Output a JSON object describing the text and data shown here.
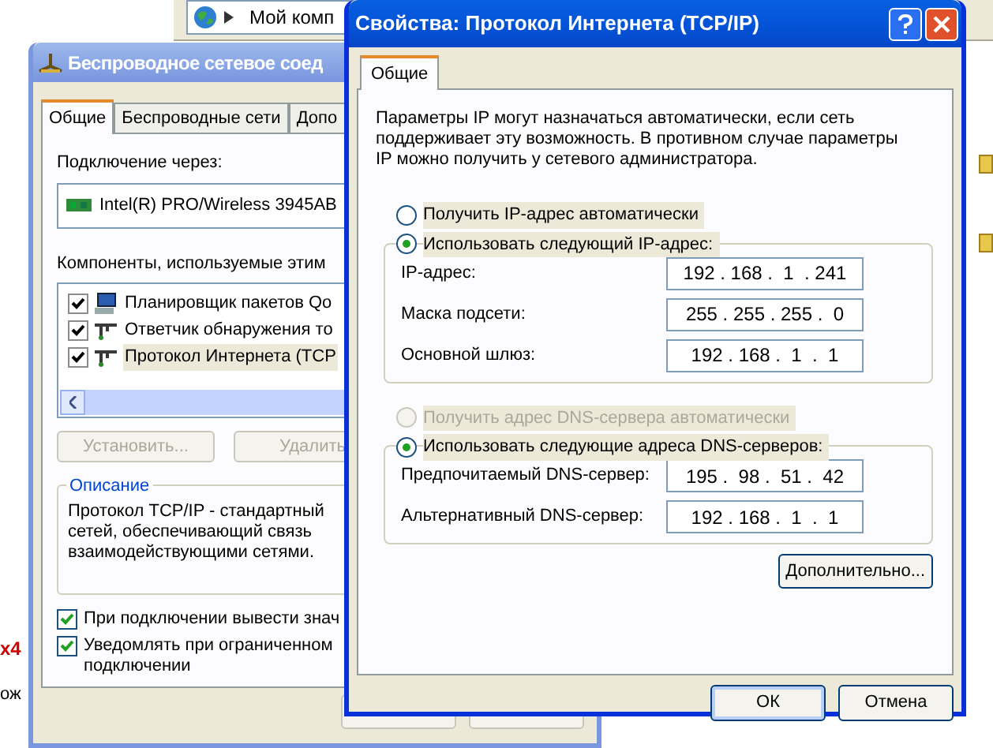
{
  "explorer_window": {
    "address": "Мой комп"
  },
  "background_texts": [
    {
      "text": "x4",
      "kind": "accent"
    },
    {
      "text": "ож",
      "kind": "plain"
    }
  ],
  "network_window": {
    "title": "Беспроводное сетевое соед",
    "tabs": [
      {
        "label": "Общие",
        "selected": true
      },
      {
        "label": "Беспроводные сети",
        "selected": false
      },
      {
        "label": "Допо",
        "selected": false
      }
    ],
    "connect_via_label": "Подключение через:",
    "adapter": "Intel(R) PRO/Wireless 3945AB",
    "components_label": "Компоненты, используемые этим",
    "components": [
      {
        "name": "Планировщик пакетов Qo",
        "checked": true,
        "kind": "scheduler"
      },
      {
        "name": "Ответчик обнаружения то",
        "checked": true,
        "kind": "protocol"
      },
      {
        "name": "Протокол Интернета (TCP",
        "checked": true,
        "kind": "protocol",
        "selected": true
      }
    ],
    "buttons": [
      {
        "label": "Установить...",
        "disabled": true
      },
      {
        "label": "Удалить",
        "disabled": true
      }
    ],
    "description": {
      "title": "Описание",
      "lines": [
        "Протокол TCP/IP - стандартный",
        "сетей, обеспечивающий связь",
        "взаимодействующими сетями."
      ]
    },
    "options": [
      {
        "lines": [
          "При подключении вывести знач"
        ],
        "checked": true
      },
      {
        "lines": [
          "Уведомлять при ограниченном",
          "подключении"
        ],
        "checked": true
      }
    ]
  },
  "tcpip_dialog": {
    "title": "Свойства: Протокол Интернета (TCP/IP)",
    "tabs": [
      {
        "label": "Общие",
        "selected": true
      }
    ],
    "intro": "Параметры IP могут назначаться автоматически, если сеть поддерживает эту возможность. В противном случае параметры IP можно получить у сетевого администратора.",
    "sections": [
      {
        "auto": {
          "label": "Получить IP-адрес автоматически",
          "selected": false,
          "disabled": false
        },
        "manual": {
          "label": "Использовать следующий IP-адрес:",
          "selected": true,
          "disabled": false
        },
        "fields": [
          {
            "label": "IP-адрес:",
            "value": "192 . 168 .  1  . 241"
          },
          {
            "label": "Маска подсети:",
            "value": "255 . 255 . 255 .  0"
          },
          {
            "label": "Основной шлюз:",
            "value": "192 . 168 .  1  .  1"
          }
        ]
      },
      {
        "auto": {
          "label": "Получить адрес DNS-сервера автоматически",
          "selected": false,
          "disabled": true
        },
        "manual": {
          "label": "Использовать следующие адреса DNS-серверов:",
          "selected": true,
          "disabled": false
        },
        "fields": [
          {
            "label": "Предпочитаемый DNS-сервер:",
            "value": "195 .  98 .  51 .  42"
          },
          {
            "label": "Альтернативный DNS-сервер:",
            "value": "192 . 168 .  1  .  1"
          }
        ]
      }
    ],
    "advanced_button": "Дополнительно...",
    "buttons": [
      {
        "label": "ОК",
        "default": true
      },
      {
        "label": "Отмена",
        "default": false
      }
    ]
  }
}
